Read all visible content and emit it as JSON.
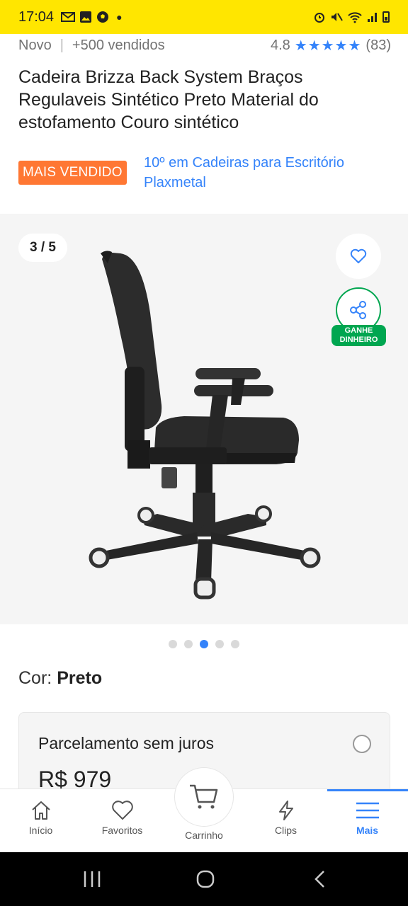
{
  "status_bar": {
    "time": "17:04",
    "left_icons": [
      "gmail-icon",
      "gallery-icon",
      "soccer-icon",
      "dot-icon"
    ],
    "right_icons": [
      "alarm-icon",
      "mute-icon",
      "wifi-icon",
      "signal-icon",
      "battery-icon"
    ]
  },
  "product": {
    "condition": "Novo",
    "sold": "+500 vendidos",
    "rating": "4.8",
    "stars": "★★★★★",
    "reviews": "(83)",
    "title": "Cadeira Brizza Back System Braços Regulaveis Sintético Preto Material do estofamento Couro sintético",
    "badge": "MAIS VENDIDO",
    "ranking": "10º em Cadeiras para Escritório Plaxmetal"
  },
  "gallery": {
    "counter": "3 / 5",
    "share_label_line1": "GANHE",
    "share_label_line2": "DINHEIRO",
    "total_images": 5,
    "active_index": 3
  },
  "color": {
    "label": "Cor: ",
    "value": "Preto"
  },
  "payment": {
    "title": "Parcelamento sem juros",
    "price": "R$ 979"
  },
  "bottom_nav": {
    "items": [
      {
        "label": "Início",
        "icon": "home-icon"
      },
      {
        "label": "Favoritos",
        "icon": "heart-icon"
      },
      {
        "label": "Carrinho",
        "icon": "cart-icon"
      },
      {
        "label": "Clips",
        "icon": "lightning-icon"
      },
      {
        "label": "Mais",
        "icon": "menu-icon"
      }
    ],
    "active": "Mais"
  },
  "colors": {
    "brand_yellow": "#ffe600",
    "accent_blue": "#3483fa",
    "badge_orange": "#ff7733",
    "green": "#00a650"
  }
}
